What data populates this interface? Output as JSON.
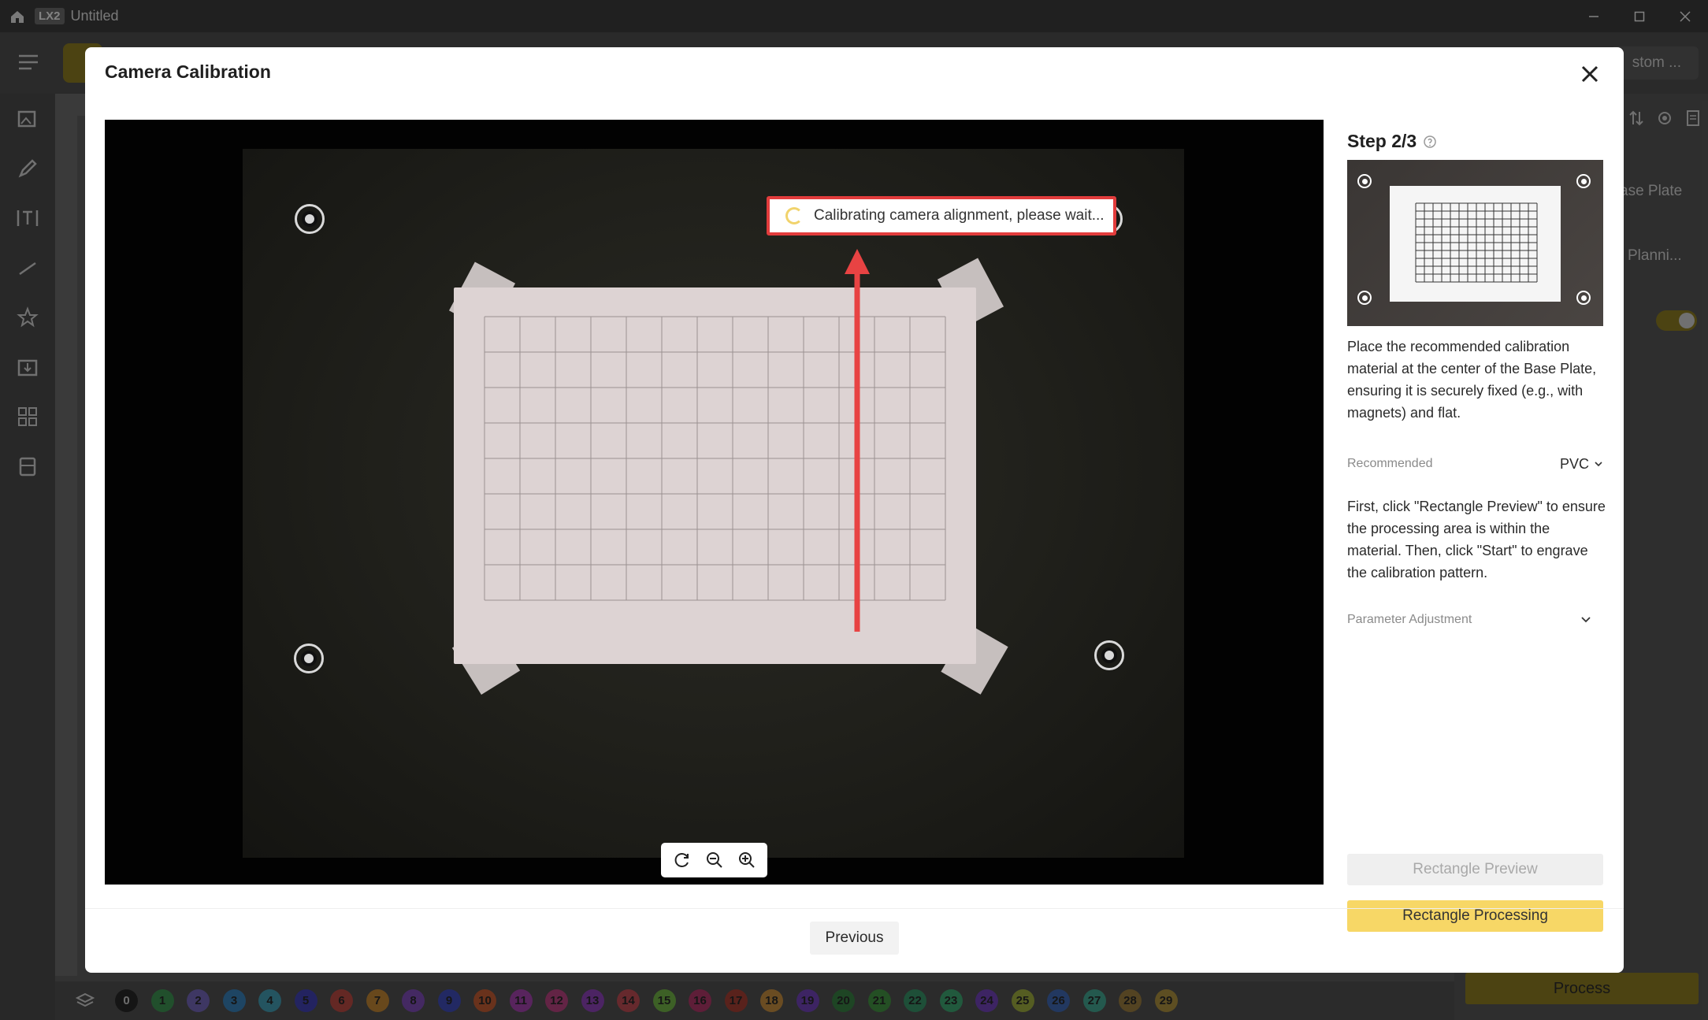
{
  "titlebar": {
    "app_badge": "LX2",
    "doc_title": "Untitled"
  },
  "toolbar": {
    "custom_label": "stom ..."
  },
  "right_panel": {
    "base_plate_label": "ase Plate",
    "planning_label": "Planni...",
    "process_label": "Process"
  },
  "layers": [
    "0",
    "1",
    "2",
    "3",
    "4",
    "5",
    "6",
    "7",
    "8",
    "9",
    "10",
    "11",
    "12",
    "13",
    "14",
    "15",
    "16",
    "17",
    "18",
    "19",
    "20",
    "21",
    "22",
    "23",
    "24",
    "25",
    "26",
    "27",
    "28",
    "29"
  ],
  "layer_colors": [
    "#1a1a1a",
    "#36a852",
    "#7d6bd8",
    "#2f8ed8",
    "#3fb3d0",
    "#3b3dcf",
    "#d9473f",
    "#e3952a",
    "#8b4bd3",
    "#3a4bd8",
    "#e6602a",
    "#bb3fc8",
    "#d83f8e",
    "#9f3fd8",
    "#e04a55",
    "#7cd042",
    "#cc2f6e",
    "#c0392b",
    "#e8a03a",
    "#7a40d8",
    "#2f8e3f",
    "#3fa83f",
    "#2fa86e",
    "#36c07a",
    "#7c3fd8",
    "#b5c93a",
    "#3a6fcf",
    "#3fc0a3",
    "#b08a3a",
    "#c9a43a"
  ],
  "modal": {
    "title": "Camera Calibration",
    "status_text": "Calibrating camera alignment, please wait...",
    "step_title": "Step 2/3",
    "desc_1": "Place the recommended calibration material at the center of the Base Plate, ensuring it is securely fixed (e.g., with magnets) and flat.",
    "recommended_label": "Recommended",
    "recommended_value": "PVC",
    "desc_2": "First, click \"Rectangle Preview\" to ensure the processing area is within the material. Then, click \"Start\" to engrave the calibration pattern.",
    "param_label": "Parameter Adjustment",
    "btn_preview": "Rectangle Preview",
    "btn_processing": "Rectangle Processing",
    "btn_previous": "Previous"
  },
  "colors": {
    "accent": "#f7d766",
    "highlight_border": "#e23c3c",
    "arrow": "#e84343"
  }
}
